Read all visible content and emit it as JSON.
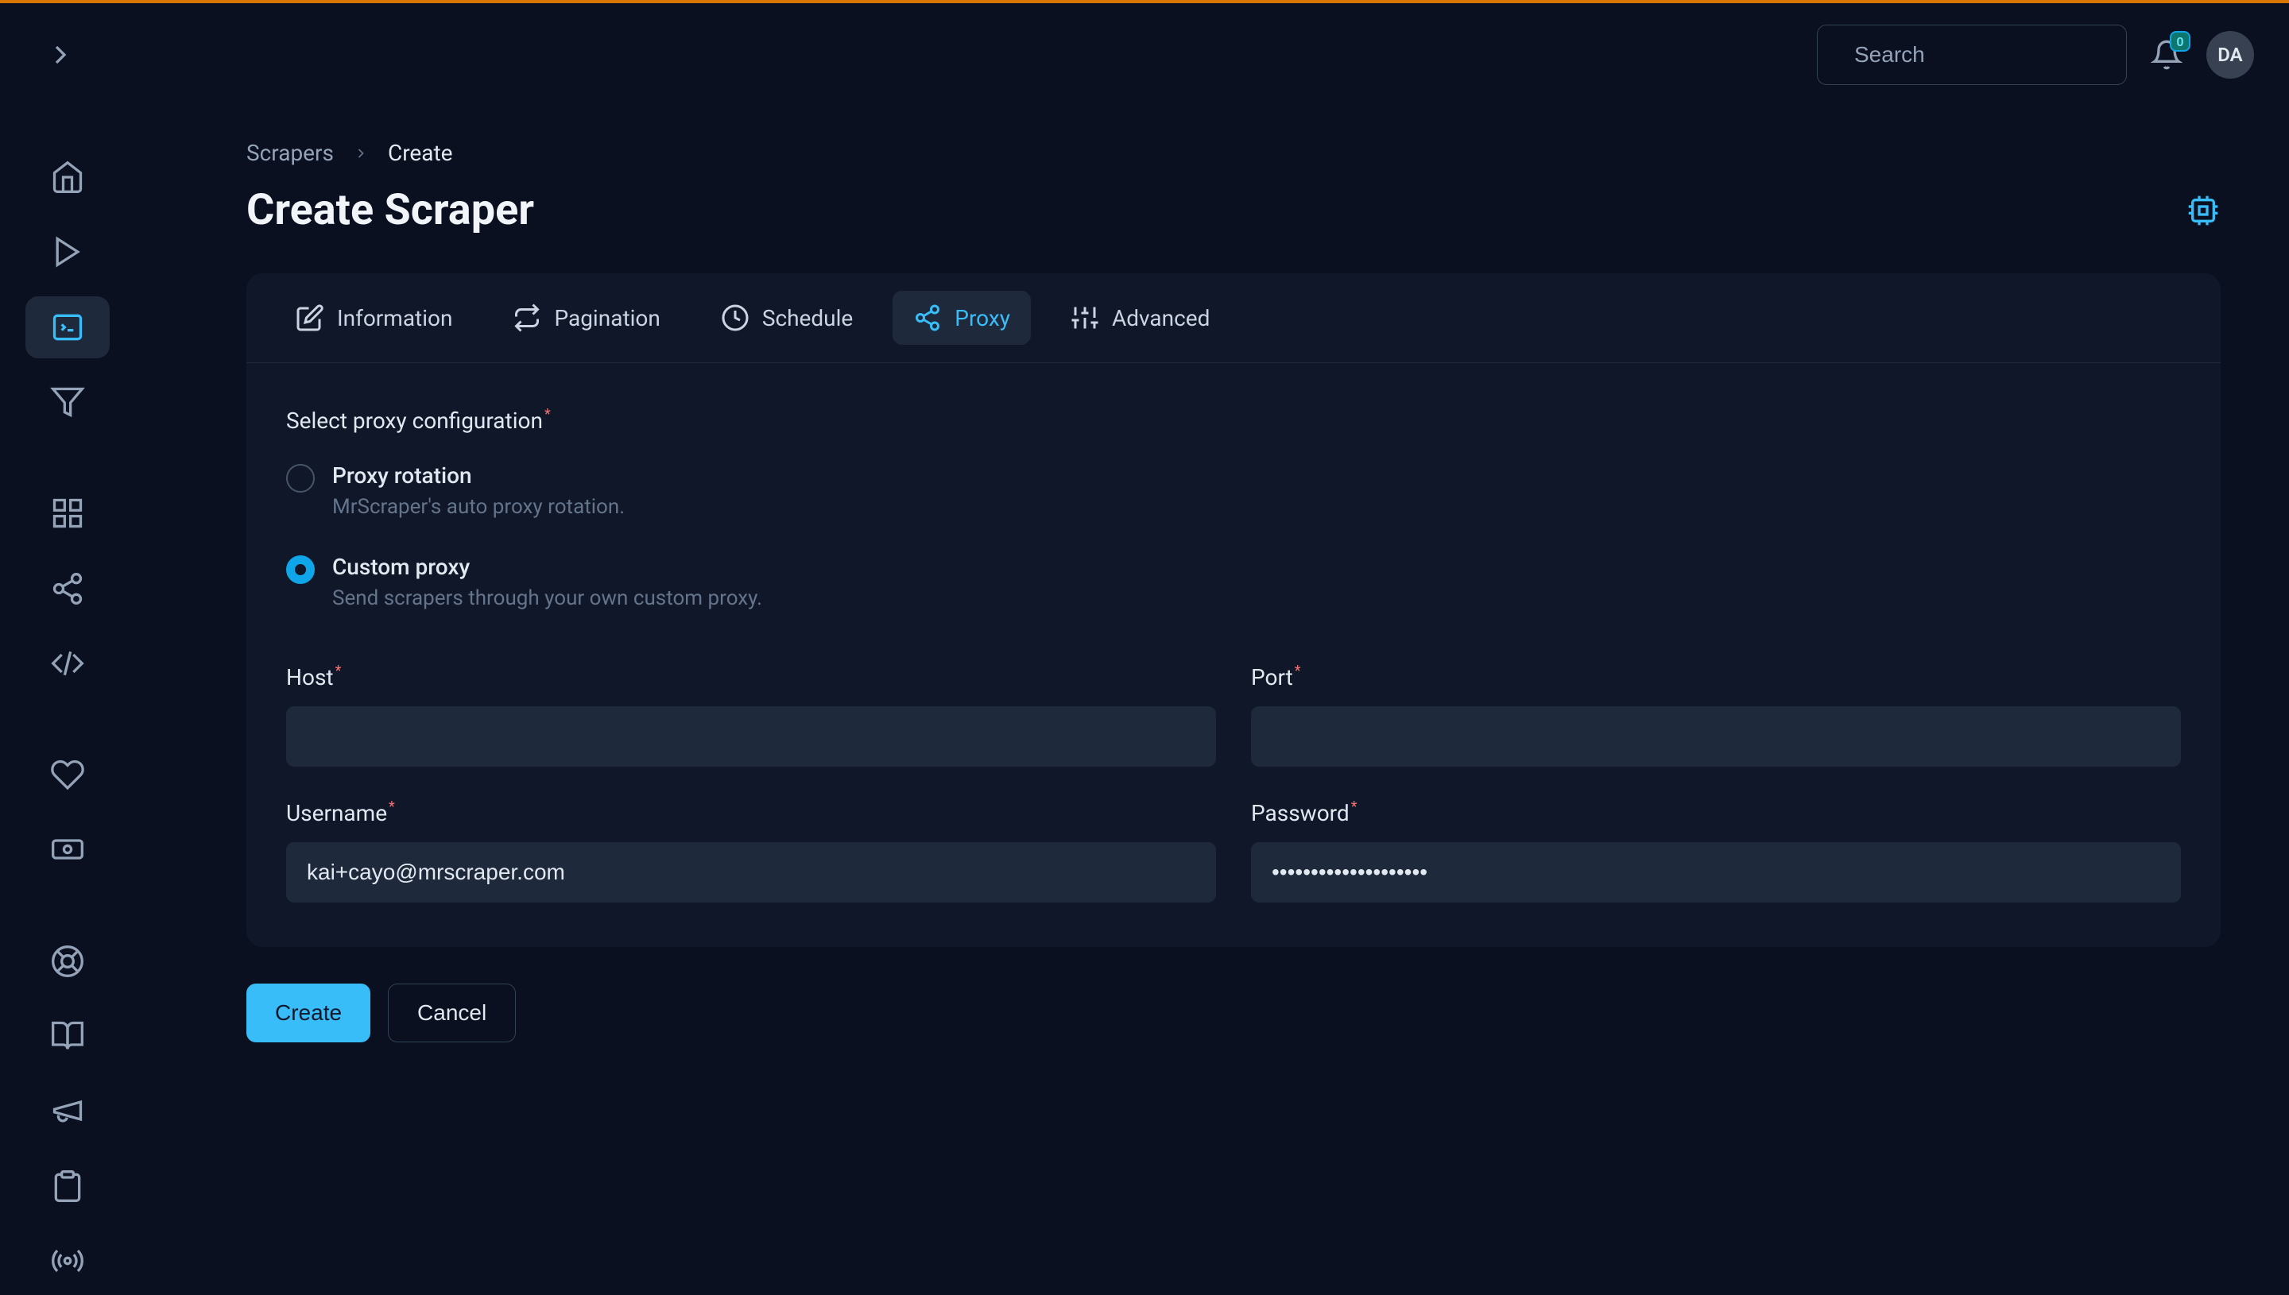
{
  "header": {
    "search_placeholder": "Search",
    "notification_count": "0",
    "avatar_initials": "DA"
  },
  "breadcrumb": {
    "root": "Scrapers",
    "current": "Create"
  },
  "page": {
    "title": "Create Scraper"
  },
  "tabs": {
    "information": "Information",
    "pagination": "Pagination",
    "schedule": "Schedule",
    "proxy": "Proxy",
    "advanced": "Advanced"
  },
  "form": {
    "proxy_config_label": "Select proxy configuration",
    "option_rotation_title": "Proxy rotation",
    "option_rotation_desc": "MrScraper's auto proxy rotation.",
    "option_custom_title": "Custom proxy",
    "option_custom_desc": "Send scrapers through your own custom proxy.",
    "host_label": "Host",
    "host_value": "",
    "port_label": "Port",
    "port_value": "",
    "username_label": "Username",
    "username_value": "kai+cayo@mrscraper.com",
    "password_label": "Password",
    "password_value": "••••••••••••••••••••"
  },
  "actions": {
    "create": "Create",
    "cancel": "Cancel"
  }
}
